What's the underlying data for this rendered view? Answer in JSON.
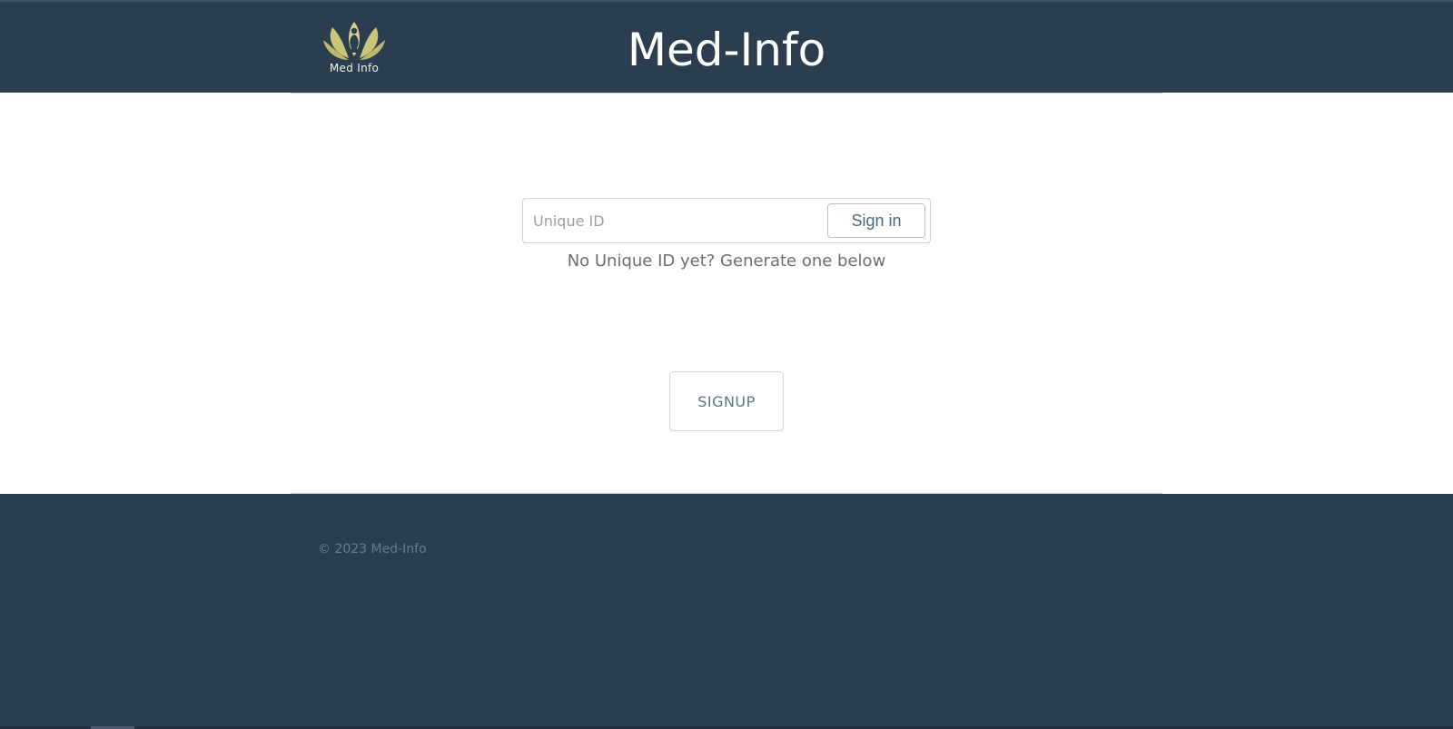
{
  "header": {
    "logo_text": "Med Info",
    "title": "Med-Info"
  },
  "signin": {
    "placeholder": "Unique ID",
    "value": "",
    "button_label": "Sign in",
    "hint": "No Unique ID yet? Generate one below"
  },
  "signup": {
    "button_label": "SIGNUP"
  },
  "footer": {
    "copyright": "© 2023 Med-Info"
  },
  "colors": {
    "header_bg": "#2b3e50",
    "logo_gold": "#d4d08a",
    "footer_text": "#5f7f8c"
  }
}
